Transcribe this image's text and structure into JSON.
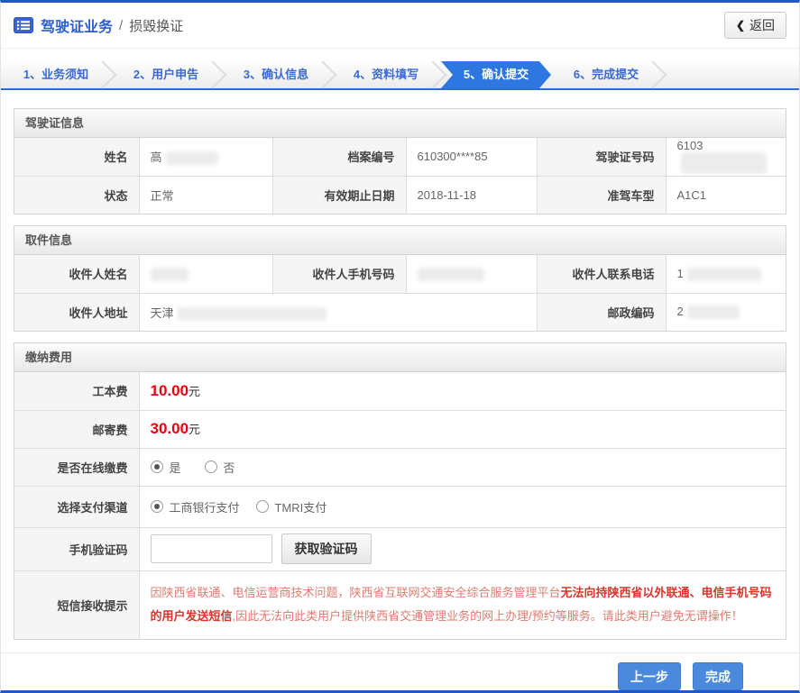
{
  "header": {
    "title": "驾驶证业务",
    "separator": "/",
    "subtitle": "损毁换证",
    "back_chevron": "❮",
    "back_label": "返回"
  },
  "steps": [
    {
      "label": "1、业务须知",
      "active": false
    },
    {
      "label": "2、用户申告",
      "active": false
    },
    {
      "label": "3、确认信息",
      "active": false
    },
    {
      "label": "4、资料填写",
      "active": false
    },
    {
      "label": "5、确认提交",
      "active": true
    },
    {
      "label": "6、完成提交",
      "active": false
    }
  ],
  "license_info": {
    "title": "驾驶证信息",
    "name_label": "姓名",
    "name_value_prefix": "高",
    "file_no_label": "档案编号",
    "file_no_value": "610300****85",
    "license_no_label": "驾驶证号码",
    "license_no_value_prefix": "6103",
    "status_label": "状态",
    "status_value": "正常",
    "expiry_label": "有效期止日期",
    "expiry_value": "2018-11-18",
    "vehicle_class_label": "准驾车型",
    "vehicle_class_value": "A1C1"
  },
  "pickup_info": {
    "title": "取件信息",
    "recipient_name_label": "收件人姓名",
    "recipient_name_value_prefix": "",
    "recipient_mobile_label": "收件人手机号码",
    "recipient_mobile_value_prefix": "",
    "recipient_phone_label": "收件人联系电话",
    "recipient_phone_value_prefix": "1",
    "recipient_address_label": "收件人地址",
    "recipient_address_value_prefix": "天津",
    "postal_code_label": "邮政编码",
    "postal_code_value_prefix": "2"
  },
  "fees": {
    "title": "缴纳费用",
    "production_fee_label": "工本费",
    "production_fee_amount": "10.00",
    "production_fee_unit": "元",
    "postage_fee_label": "邮寄费",
    "postage_fee_amount": "30.00",
    "postage_fee_unit": "元",
    "online_payment_label": "是否在线缴费",
    "online_payment_options": [
      {
        "label": "是",
        "selected": true
      },
      {
        "label": "否",
        "selected": false
      }
    ],
    "payment_channel_label": "选择支付渠道",
    "payment_channel_options": [
      {
        "label": "工商银行支付",
        "selected": true
      },
      {
        "label": "TMRI支付",
        "selected": false
      }
    ],
    "sms_code_label": "手机验证码",
    "sms_code_value": "",
    "get_code_button": "获取验证码",
    "sms_notice_label": "短信接收提示",
    "sms_notice_part1": "因陕西省联通、电信运营商技术问题，陕西省互联网交通安全综合服务管理平台",
    "sms_notice_part2": "无法向持陕西省以外联通、电信手机号码的用户发送短信",
    "sms_notice_part3": ",因此无法向此类用户提供陕西省交通管理业务的网上办理/预约等服务。请此类用户避免无谓操作！"
  },
  "footer": {
    "prev_button": "上一步",
    "finish_button": "完成"
  },
  "colors": {
    "accent_blue": "#2b6bd8",
    "active_step_blue": "#2f77e0",
    "button_blue": "#4a89dc",
    "fee_red": "#e60012",
    "notice_red": "#d9352b"
  }
}
